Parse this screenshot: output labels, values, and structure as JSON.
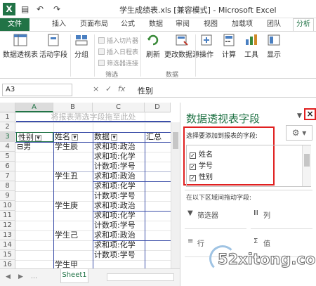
{
  "window": {
    "title": "学生成绩表.xls  [兼容模式] - Microsoft Excel",
    "logo_letter": "X"
  },
  "quick_access": {
    "save_glyph": "▤",
    "undo_glyph": "↶",
    "redo_glyph": "↷"
  },
  "ribbon_tabs": [
    "文件",
    "插入",
    "页面布局",
    "公式",
    "数据",
    "审阅",
    "视图",
    "加载项",
    "团队",
    "分析"
  ],
  "ribbon": {
    "buttons": [
      "数据透视表",
      "活动字段",
      "分组",
      "刷新",
      "更改数据源",
      "操作",
      "计算",
      "工具",
      "显示"
    ],
    "filter_small": [
      "插入切片器",
      "插入日程表",
      "筛选器连接"
    ],
    "groups": [
      "筛选",
      "数据"
    ]
  },
  "formula_bar": {
    "name_box": "A3",
    "x_glyph": "×",
    "check_glyph": "✓",
    "fx": "fx",
    "content": "性别"
  },
  "sheet": {
    "columns": [
      "A",
      "B",
      "C",
      "D"
    ],
    "rows": [
      "1",
      "2",
      "3",
      "4",
      "5",
      "6",
      "7",
      "8",
      "9",
      "10",
      "11",
      "12",
      "13",
      "14",
      "15",
      "16"
    ],
    "filter_hint": "将报表筛选字段拖至此处",
    "headers": {
      "gender": "性别",
      "name": "姓名",
      "data": "数据",
      "total": "汇总"
    },
    "collapse_glyph": "⊟",
    "group_label": "男",
    "students": [
      "学生辰",
      "学生丑",
      "学生庚",
      "学生己",
      "学生甲"
    ],
    "data_items": [
      "求和项:政治",
      "求和项:化学",
      "计数项:学号"
    ],
    "tab_name": "Sheet1"
  },
  "pivot_pane": {
    "title": "数据透视表字段",
    "close_glyph": "×",
    "choose_label": "选择要添加到报表的字段:",
    "gear_glyph": "⚙ ▾",
    "fields": [
      {
        "name": "姓名",
        "checked": true
      },
      {
        "name": "学号",
        "checked": true
      },
      {
        "name": "性别",
        "checked": true
      }
    ],
    "drag_label": "在以下区域间拖动字段:",
    "areas": [
      "筛选器",
      "列",
      "行",
      "值"
    ]
  },
  "watermark": "52xitong.com"
}
